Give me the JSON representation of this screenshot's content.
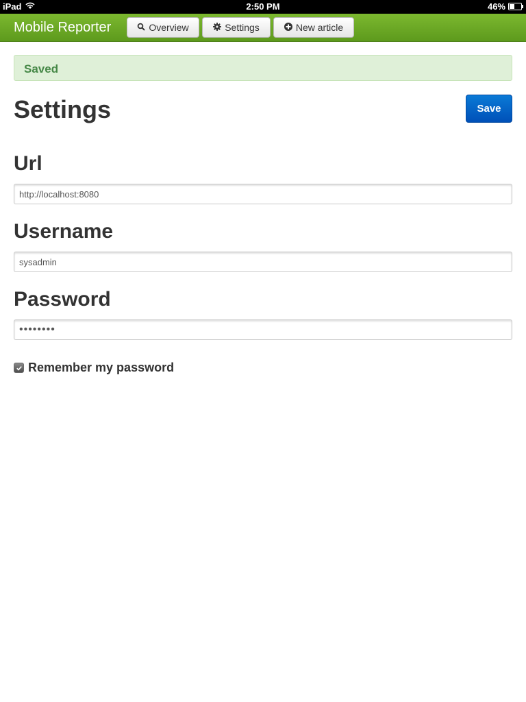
{
  "status_bar": {
    "device": "iPad",
    "time": "2:50 PM",
    "battery_text": "46%",
    "battery_level": 0.46,
    "wifi_icon": "wifi-icon"
  },
  "navbar": {
    "brand": "Mobile Reporter",
    "color": "#6aa823",
    "buttons": [
      {
        "label": "Overview",
        "icon": "search-icon"
      },
      {
        "label": "Settings",
        "icon": "gear-icon"
      },
      {
        "label": "New article",
        "icon": "plus-circle-icon"
      }
    ]
  },
  "alert": {
    "text": "Saved",
    "bg_color": "#dff0d8",
    "text_color": "#468847"
  },
  "page": {
    "title": "Settings",
    "save_label": "Save",
    "save_color": "#0065cc"
  },
  "form": {
    "url_label": "Url",
    "url_value": "http://localhost:8080",
    "username_label": "Username",
    "username_value": "sysadmin",
    "password_label": "Password",
    "password_value": "••••••••",
    "remember_label": "Remember my password",
    "remember_checked": true
  }
}
